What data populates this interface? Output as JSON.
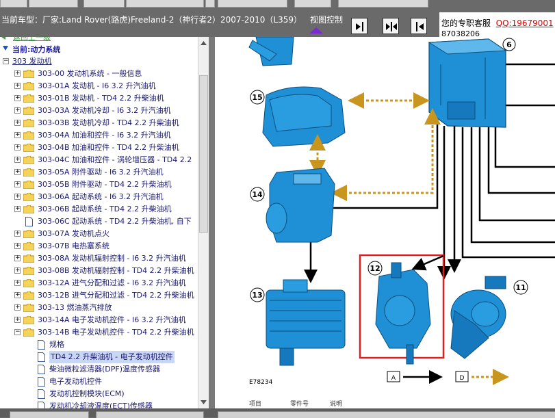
{
  "header": {
    "vehicle_title": "当前车型：厂家:Land Rover(路虎)Freeland-2（神行者2）2007-2010（L359）",
    "view_control_label": "视图控制"
  },
  "service": {
    "label": "您的专职客服",
    "qq": "QQ:19679001",
    "phone": "87038206"
  },
  "tree": {
    "root_link": "返回上一级",
    "current_label": "当前:动力系统",
    "engine_node": "303 发动机",
    "items": [
      "303-00 发动机系统 - 一般信息",
      "303-01A 发动机 - I6 3.2 升汽油机",
      "303-01B 发动机 - TD4 2.2 升柴油机",
      "303-03A 发动机冷却 - I6 3.2 升汽油机",
      "303-03B 发动机冷却 - TD4 2.2 升柴油机",
      "303-04A 加油和控件 - I6 3.2 升汽油机",
      "303-04B 加油和控件 - TD4 2.2 升柴油机",
      "303-04C 加油和控件 - 涡轮增压器 - TD4 2.2",
      "303-05A 附件驱动 - I6 3.2 升汽油机",
      "303-05B 附件驱动 - TD4 2.2 升柴油机",
      "303-06A 起动系统 - I6 3.2 升汽油机",
      "303-06B 起动系统 - TD4 2.2 升柴油机",
      "303-06C 起动系统 - TD4 2.2 升柴油机, 自下",
      "303-07A 发动机点火",
      "303-07B 电热塞系统",
      "303-08A 发动机辐射控制 - I6 3.2 升汽油机",
      "303-08B 发动机辐射控制 - TD4 2.2 升柴油机",
      "303-12A 进气分配和过滤 - I6 3.2 升汽油机",
      "303-12B 进气分配和过滤 - TD4 2.2 升柴油机",
      "303-13 燃油蒸汽排放",
      "303-14A 电子发动机控件 - I6 3.2 升汽油机",
      "303-14B 电子发动机控件 - TD4 2.2 升柴油机"
    ],
    "children": [
      "规格",
      "TD4 2.2 升柴油机 - 电子发动机控件",
      "柴油微粒滤清器(DPF)温度传感器",
      "电子发动机控件",
      "发动机控制模块(ECM)",
      "发动机冷却液温度(ECT)传感器"
    ]
  },
  "diagram": {
    "callouts": [
      "6",
      "15",
      "14",
      "13",
      "12",
      "11"
    ],
    "figure_ref": "E78234",
    "legend_a": "A",
    "legend_d": "D",
    "columns": [
      "项目",
      "零件号",
      "说明"
    ]
  },
  "colors": {
    "part_blue": "#1f8fd6",
    "arrow_gold": "#c8961e",
    "highlight_red": "#e02020",
    "tree_text": "#1a1a6e"
  }
}
